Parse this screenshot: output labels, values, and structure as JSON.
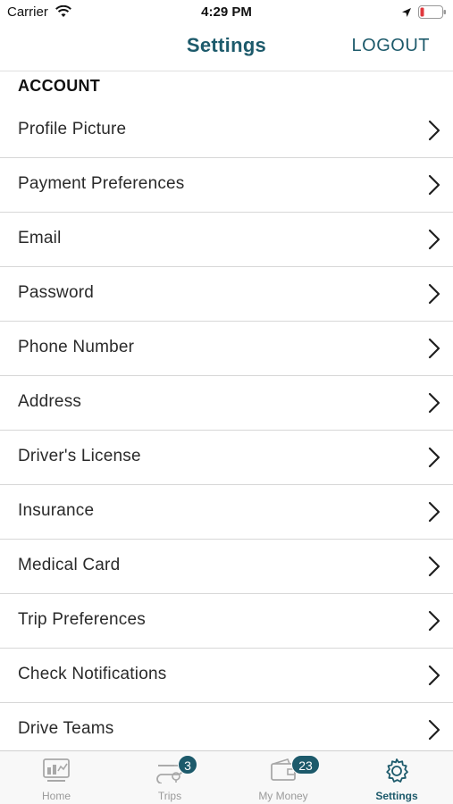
{
  "status_bar": {
    "carrier": "Carrier",
    "time": "4:29 PM"
  },
  "nav": {
    "title": "Settings",
    "logout_label": "LOGOUT"
  },
  "section": {
    "title": "ACCOUNT"
  },
  "settings_items": [
    {
      "label": "Profile Picture"
    },
    {
      "label": "Payment Preferences"
    },
    {
      "label": "Email"
    },
    {
      "label": "Password"
    },
    {
      "label": "Phone Number"
    },
    {
      "label": "Address"
    },
    {
      "label": "Driver's License"
    },
    {
      "label": "Insurance"
    },
    {
      "label": "Medical Card"
    },
    {
      "label": "Trip Preferences"
    },
    {
      "label": "Check Notifications"
    },
    {
      "label": "Drive Teams"
    }
  ],
  "tabs": [
    {
      "label": "Home",
      "icon": "home-chart-icon"
    },
    {
      "label": "Trips",
      "icon": "trips-route-icon",
      "badge": "3"
    },
    {
      "label": "My Money",
      "icon": "wallet-icon",
      "badge": "23"
    },
    {
      "label": "Settings",
      "icon": "gear-icon",
      "active": true
    }
  ],
  "colors": {
    "accent": "#1d5a6b",
    "inactive_tab": "#9a9a9a",
    "battery_low": "#e0393e"
  }
}
